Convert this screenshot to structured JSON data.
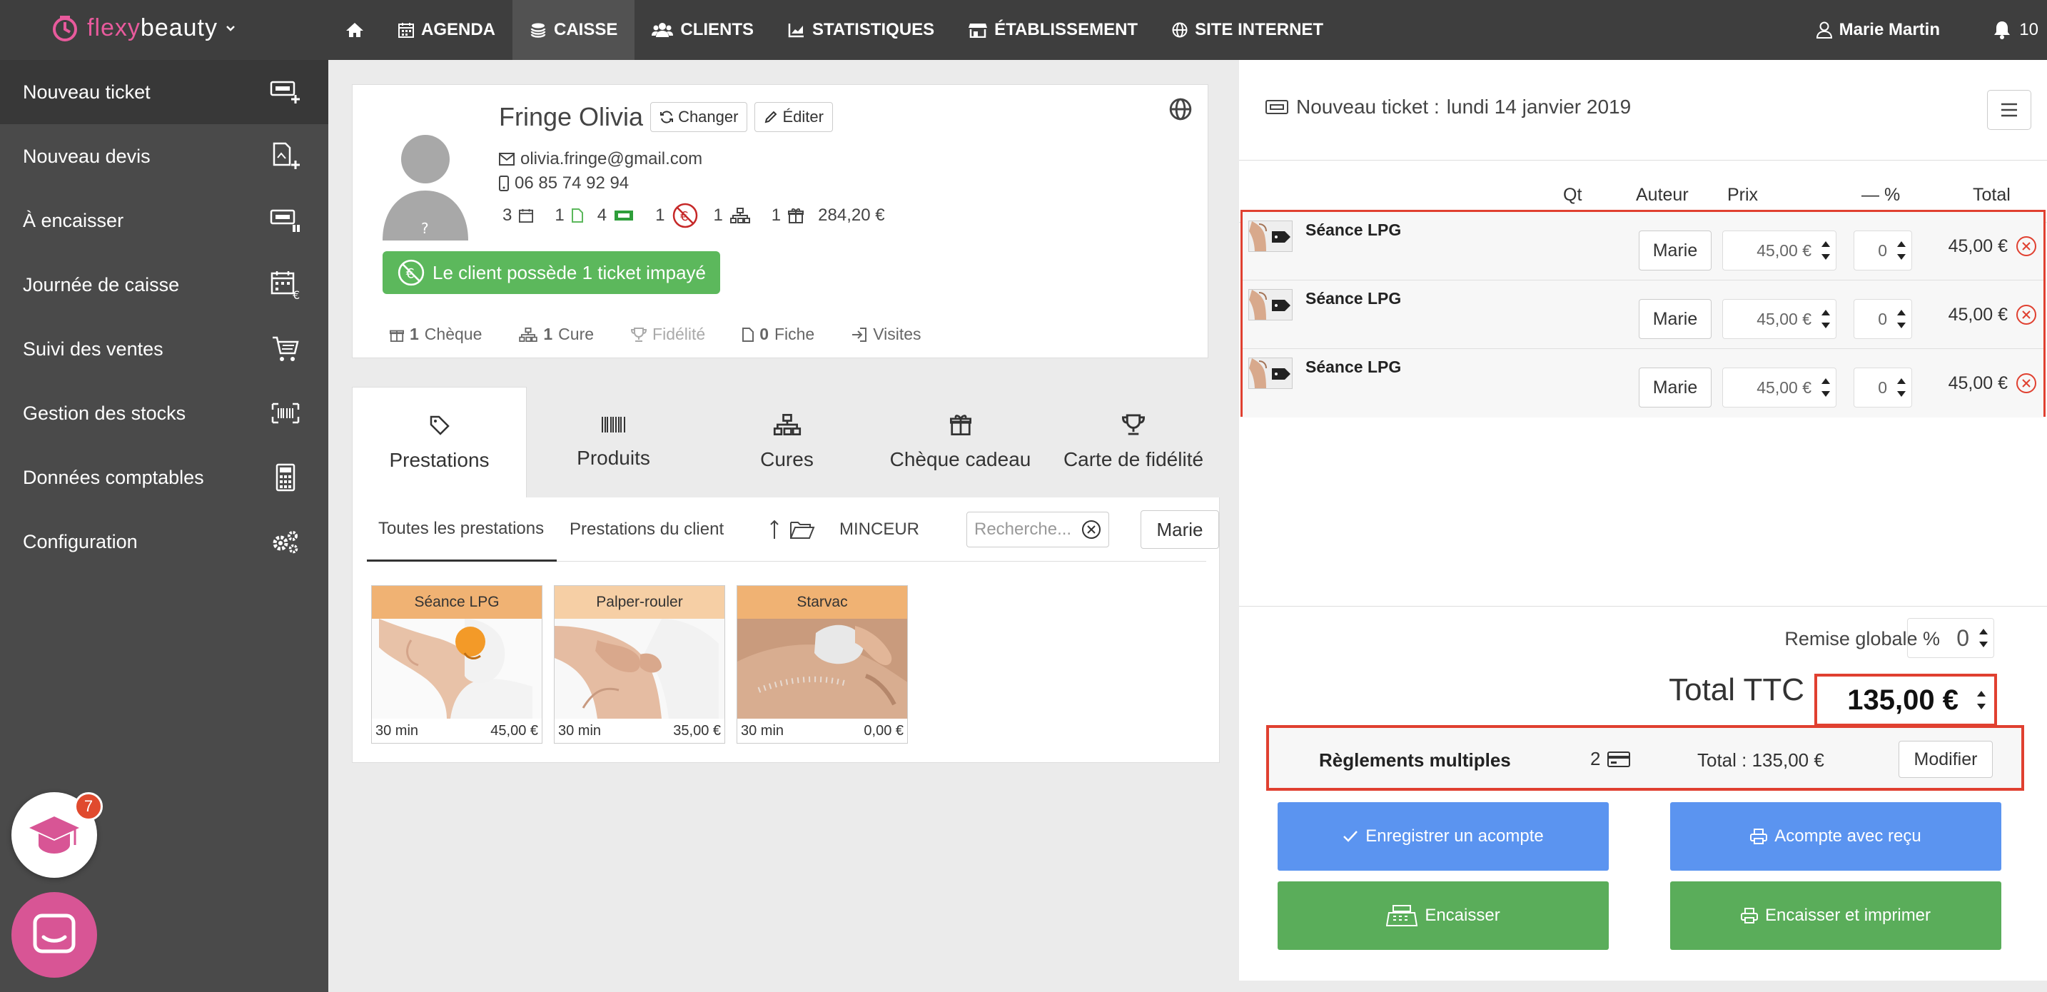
{
  "app": {
    "logo_pre": "flexy",
    "logo_post": "beauty"
  },
  "nav": {
    "items": [
      {
        "label": "",
        "icon": "home-icon"
      },
      {
        "label": "AGENDA",
        "icon": "calendar-icon"
      },
      {
        "label": "CAISSE",
        "icon": "coins-icon"
      },
      {
        "label": "CLIENTS",
        "icon": "users-icon"
      },
      {
        "label": "STATISTIQUES",
        "icon": "chart-icon"
      },
      {
        "label": "ÉTABLISSEMENT",
        "icon": "store-icon"
      },
      {
        "label": "SITE INTERNET",
        "icon": "globe-icon"
      }
    ],
    "user": "Marie Martin",
    "notifications": "10"
  },
  "sidebar": {
    "items": [
      {
        "label": "Nouveau ticket",
        "icon": "new-ticket-icon"
      },
      {
        "label": "Nouveau devis",
        "icon": "new-quote-icon"
      },
      {
        "label": "À encaisser",
        "icon": "to-cash-icon"
      },
      {
        "label": "Journée de caisse",
        "icon": "cash-day-icon"
      },
      {
        "label": "Suivi des ventes",
        "icon": "cart-icon"
      },
      {
        "label": "Gestion des stocks",
        "icon": "barcode-icon"
      },
      {
        "label": "Données comptables",
        "icon": "calculator-icon"
      },
      {
        "label": "Configuration",
        "icon": "gears-icon"
      }
    ]
  },
  "client": {
    "name": "Fringe Olivia",
    "change": "Changer",
    "edit": "Éditer",
    "email": "olivia.fringe@gmail.com",
    "phone": "06 85 74 92 94",
    "stats": {
      "rdv": "3",
      "docs": "1",
      "tickets": "4",
      "unpaid": "1",
      "cures": "1",
      "gifts": "1",
      "amount": "284,20 €"
    },
    "unpaid_msg": "Le client possède 1 ticket impayé",
    "links": {
      "cheque_n": "1",
      "cheque": "Chèque",
      "cure_n": "1",
      "cure": "Cure",
      "fidelite": "Fidélité",
      "fiche_n": "0",
      "fiche": "Fiche",
      "visites": "Visites"
    }
  },
  "catalog": {
    "tabs": [
      "Prestations",
      "Produits",
      "Cures",
      "Chèque cadeau",
      "Carte de fidélité"
    ],
    "subtabs": [
      "Toutes les prestations",
      "Prestations du client"
    ],
    "category": "MINCEUR",
    "search_placeholder": "Recherche...",
    "staff": "Marie",
    "products": [
      {
        "name": "Séance LPG",
        "duration": "30 min",
        "price": "45,00 €",
        "color": "#f0b273"
      },
      {
        "name": "Palper-rouler",
        "duration": "30 min",
        "price": "35,00 €",
        "color": "#f6cfa5"
      },
      {
        "name": "Starvac",
        "duration": "30 min",
        "price": "0,00 €",
        "color": "#f0b273"
      }
    ]
  },
  "ticket": {
    "title": "Nouveau ticket :",
    "date": "lundi 14 janvier 2019",
    "headers": {
      "qt": "Qt",
      "author": "Auteur",
      "price": "Prix",
      "discount": "— %",
      "total": "Total"
    },
    "lines": [
      {
        "name": "Séance LPG",
        "author": "Marie",
        "price": "45,00 €",
        "discount": "0",
        "total": "45,00 €"
      },
      {
        "name": "Séance LPG",
        "author": "Marie",
        "price": "45,00 €",
        "discount": "0",
        "total": "45,00 €"
      },
      {
        "name": "Séance LPG",
        "author": "Marie",
        "price": "45,00 €",
        "discount": "0",
        "total": "45,00 €"
      }
    ],
    "remise_label": "Remise globale %",
    "remise_value": "0",
    "total_label": "Total TTC",
    "total_value": "135,00 €",
    "reglement": {
      "label": "Règlements multiples",
      "count": "2",
      "total": "Total : 135,00 €",
      "modify": "Modifier"
    },
    "actions": {
      "acompte": "Enregistrer un acompte",
      "acompte_recu": "Acompte avec reçu",
      "encaisser": "Encaisser",
      "encaisser_imprimer": "Encaisser et imprimer"
    }
  },
  "widgets": {
    "academy_badge": "7"
  },
  "colors": {
    "accent_pink": "#e85a9c",
    "topbar": "#3e3e3e",
    "sidebar": "#4a4a4a",
    "success": "#5cb85c",
    "primary": "#5b94f0",
    "danger": "#e04030"
  }
}
